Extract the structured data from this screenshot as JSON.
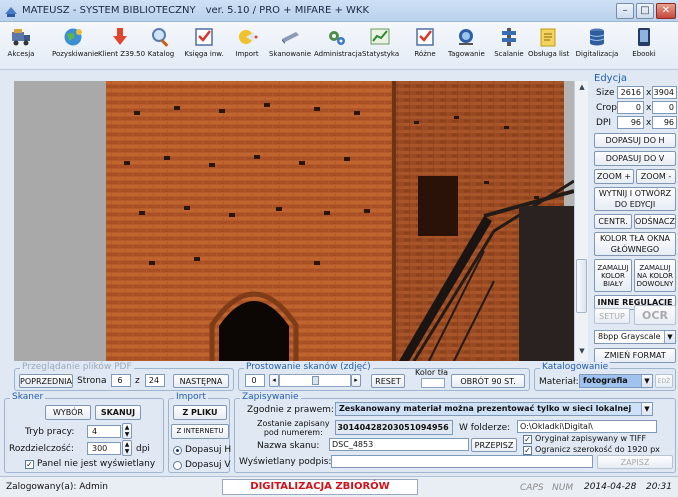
{
  "window": {
    "title": "MATEUSZ - SYSTEM BIBLIOTECZNY",
    "version": "ver. 5.10 / PRO + MIFARE + WKK",
    "minimize": "–",
    "maximize": "□",
    "close": "✕"
  },
  "toolbar": [
    {
      "label": "Akcesja",
      "icon": "truck-icon"
    },
    {
      "label": "Pozyskiwanie",
      "icon": "globe-icon"
    },
    {
      "label": "Klient Z39.50",
      "icon": "download-arrow-icon"
    },
    {
      "label": "Katalog",
      "icon": "magnifier-icon"
    },
    {
      "label": "Księga inw.",
      "icon": "checklist-icon"
    },
    {
      "label": "Import",
      "icon": "import-icon"
    },
    {
      "label": "Skanowanie",
      "icon": "scanner-icon"
    },
    {
      "label": "Administracja",
      "icon": "gears-icon"
    },
    {
      "label": "Statystyka",
      "icon": "chart-icon"
    },
    {
      "label": "Różne",
      "icon": "checklist-icon"
    },
    {
      "label": "Tagowanie",
      "icon": "tag-icon"
    },
    {
      "label": "Scalanie",
      "icon": "merge-icon"
    },
    {
      "label": "Obsługa list",
      "icon": "notes-icon"
    },
    {
      "label": "Digitalizacja",
      "icon": "database-icon"
    },
    {
      "label": "Ebooki",
      "icon": "ebook-icon"
    }
  ],
  "edycja": {
    "title": "Edycja",
    "size_label": "Size",
    "size_w": "2616",
    "size_h": "3904",
    "crop_label": "Crop",
    "crop_w": "0",
    "crop_h": "0",
    "dpi_label": "DPI",
    "dpi_w": "96",
    "dpi_h": "96",
    "x": "x",
    "fit_h": "DOPASUJ DO H",
    "fit_v": "DOPASUJ DO V",
    "zoom_in": "ZOOM +",
    "zoom_out": "ZOOM -",
    "cut_open": "WYTNIJ I OTWÓRZ DO EDYCJI",
    "center": "CENTR.",
    "refresh": "ODŚNACZ",
    "bg_color": "KOLOR TŁA OKNA GŁÓWNEGO",
    "paint_white": "ZAMALUJ KOLOR BIAŁY",
    "paint_any": "ZAMALUJ NA KOLOR DOWOLNY",
    "other_settings": "INNE REGULACJE",
    "setup": "SETUP",
    "ocr": "OCR",
    "format_value": "8bpp Grayscale",
    "change_format": "ZMIEŃ FORMAT"
  },
  "pdf": {
    "title": "Przeglądanie plików PDF",
    "prev": "POPRZEDNIA",
    "page_label": "Strona",
    "page": "6",
    "of": "z",
    "total": "24",
    "next": "NASTĘPNA"
  },
  "deskew": {
    "title": "Prostowanie skanów (zdjęć)",
    "value": "0",
    "reset": "RESET",
    "bg_color_label": "Kolor tła",
    "rotate": "OBRÓT 90 ST."
  },
  "catalog": {
    "title": "Katalogowanie",
    "material_label": "Materiał:",
    "material_value": "fotografia",
    "edit": "EDŻ"
  },
  "scanner": {
    "title": "Skaner",
    "choose": "WYBÓR",
    "scan": "SKANUJ",
    "mode_label": "Tryb pracy:",
    "mode_value": "4",
    "res_label": "Rozdzielczość:",
    "res_value": "300",
    "dpi": "dpi",
    "panel_hidden": "Panel nie jest wyświetlany"
  },
  "import": {
    "title": "Import",
    "from_file": "Z PLIKU",
    "from_internet": "Z INTERNETU",
    "fit_h": "Dopasuj H",
    "fit_v": "Dopasuj V"
  },
  "save": {
    "title": "Zapisywanie",
    "law_label": "Zgodnie z prawem:",
    "law_value": "Zeskanowany materiał można prezentować tylko w sieci lokalnej",
    "saved_label_1": "Zostanie zapisany",
    "saved_label_2": "pod numerem:",
    "number": "30140428203051094956",
    "folder_label": "W folderze:",
    "folder_value": "O:\\Okladki\\Digital\\",
    "scan_name_label": "Nazwa skanu:",
    "scan_name_value": "DSC_4853",
    "rename": "PRZEPISZ",
    "orig_tiff": "Oryginał zapisywany w TIFF",
    "limit_width": "Ogranicz szerokość do 1920 px",
    "caption_label": "Wyświetlany podpis:",
    "caption_value": "",
    "save_btn": "ZAPISZ"
  },
  "status": {
    "user": "Zalogowany(a): Admin",
    "banner": "DIGITALIZACJA ZBIORÓW",
    "caps": "CAPS",
    "num": "NUM",
    "date": "2014-04-28",
    "time": "20:31"
  },
  "colors": {
    "accent": "#1f5fb0",
    "banner_text": "#d0101c",
    "brick": "#b85a2e",
    "sky": "#b3b3b3"
  }
}
